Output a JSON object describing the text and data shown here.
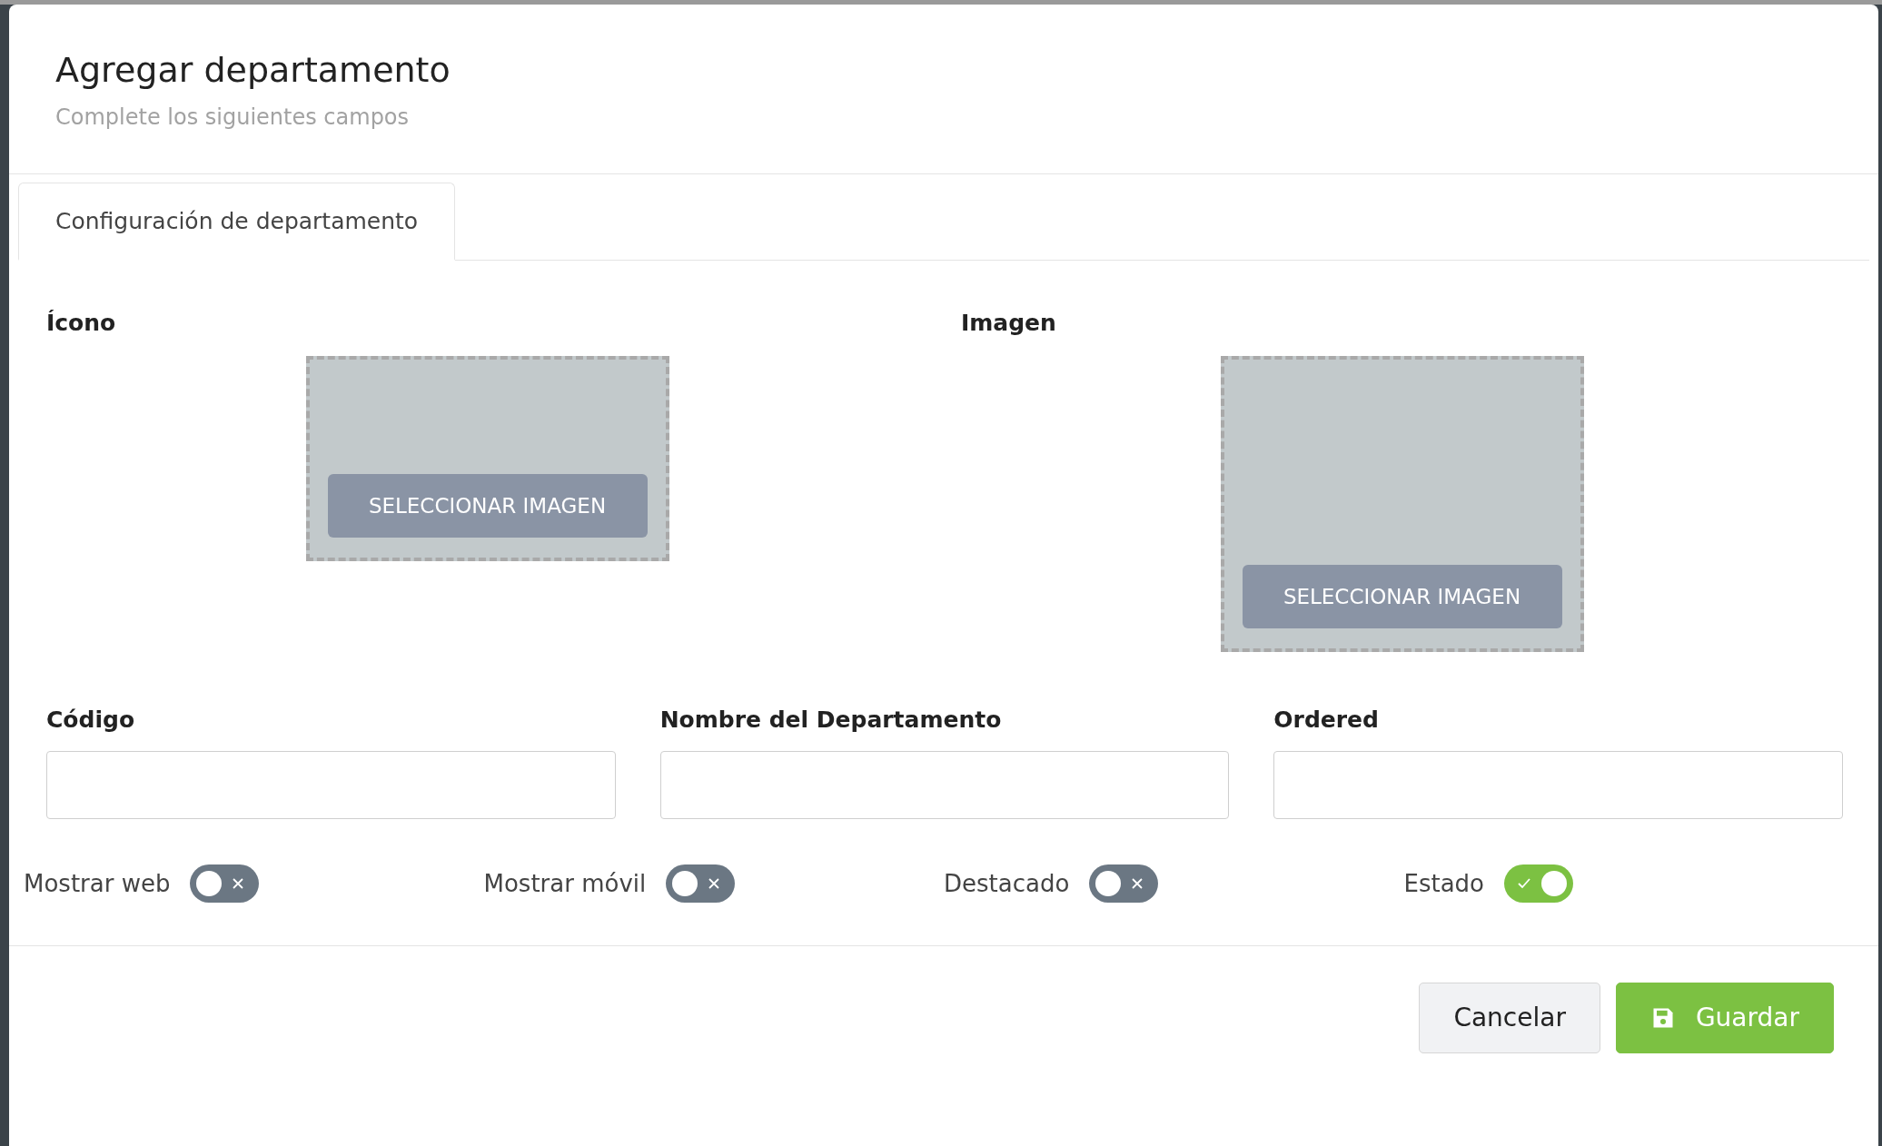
{
  "dialog": {
    "title": "Agregar departamento",
    "subtitle": "Complete los siguientes campos"
  },
  "tabs": [
    {
      "label": "Configuración de departamento",
      "selected": true
    }
  ],
  "uploads": [
    {
      "label": "Ícono",
      "button": "SELECCIONAR IMAGEN",
      "kind": "icon"
    },
    {
      "label": "Imagen",
      "button": "SELECCIONAR IMAGEN",
      "kind": "image"
    }
  ],
  "fields": [
    {
      "label": "Código"
    },
    {
      "label": "Nombre del Departamento"
    },
    {
      "label": "Ordered"
    }
  ],
  "toggles": [
    {
      "label": "Mostrar web",
      "on": false
    },
    {
      "label": "Mostrar móvil",
      "on": false
    },
    {
      "label": "Destacado",
      "on": false
    },
    {
      "label": "Estado",
      "on": true
    }
  ],
  "buttons": [
    {
      "label": "Cancelar",
      "kind": "secondary"
    },
    {
      "label": "Guardar",
      "kind": "primary"
    }
  ]
}
